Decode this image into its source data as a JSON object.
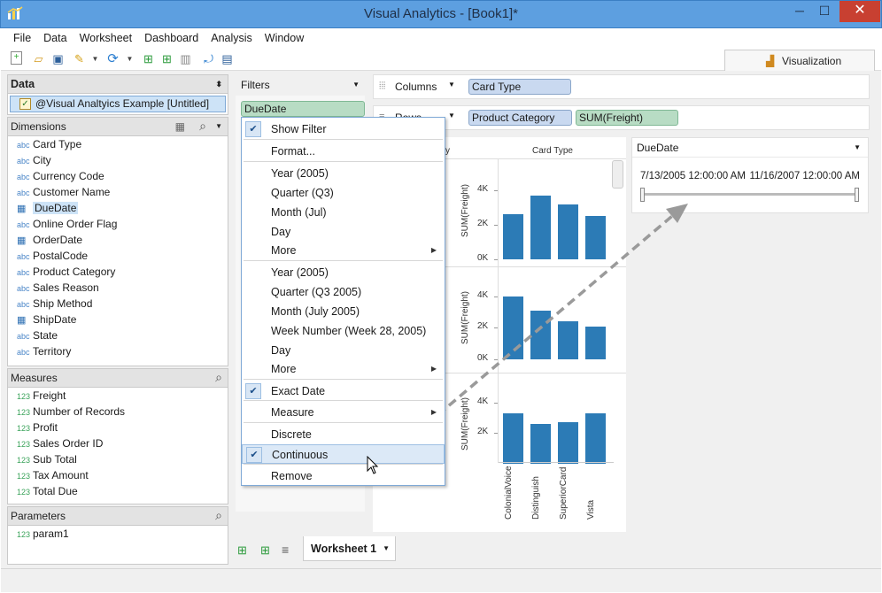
{
  "window": {
    "title": "Visual Analytics - [Book1]*",
    "minimize": "─",
    "maximize": "☐",
    "close": "✕"
  },
  "menu": [
    "File",
    "Data",
    "Worksheet",
    "Dashboard",
    "Analysis",
    "Window"
  ],
  "viz_tab": "Visualization",
  "data_pane": {
    "header": "Data",
    "datasource": "@Visual Analtyics Example [Untitled]",
    "dimensions_header": "Dimensions",
    "dimensions": [
      {
        "type": "abc",
        "label": "Card Type"
      },
      {
        "type": "abc",
        "label": "City"
      },
      {
        "type": "abc",
        "label": "Currency Code"
      },
      {
        "type": "abc",
        "label": "Customer Name"
      },
      {
        "type": "date",
        "label": "DueDate"
      },
      {
        "type": "abc",
        "label": "Online Order Flag"
      },
      {
        "type": "date",
        "label": "OrderDate"
      },
      {
        "type": "abc",
        "label": "PostalCode"
      },
      {
        "type": "abc",
        "label": "Product Category"
      },
      {
        "type": "abc",
        "label": "Sales Reason"
      },
      {
        "type": "abc",
        "label": "Ship Method"
      },
      {
        "type": "date",
        "label": "ShipDate"
      },
      {
        "type": "abc",
        "label": "State"
      },
      {
        "type": "abc",
        "label": "Territory"
      }
    ],
    "measures_header": "Measures",
    "measures": [
      {
        "type": "123",
        "label": "Freight"
      },
      {
        "type": "123",
        "label": "Number of Records"
      },
      {
        "type": "123",
        "label": "Profit"
      },
      {
        "type": "123",
        "label": "Sales Order ID"
      },
      {
        "type": "123",
        "label": "Sub Total"
      },
      {
        "type": "123",
        "label": "Tax Amount"
      },
      {
        "type": "123",
        "label": "Total Due"
      }
    ],
    "parameters_header": "Parameters",
    "parameters": [
      {
        "type": "123",
        "label": "param1"
      }
    ]
  },
  "filters": {
    "header": "Filters",
    "pill": "DueDate"
  },
  "shelves": {
    "columns_label": "Columns",
    "columns_pills": [
      "Card Type"
    ],
    "rows_label": "Rows",
    "rows_pills": [
      "Product Category",
      "SUM(Freight)"
    ]
  },
  "context_menu": [
    {
      "label": "Show Filter",
      "checked": true
    },
    {
      "label": "Format..."
    },
    {
      "label": "Year (2005)"
    },
    {
      "label": "Quarter (Q3)"
    },
    {
      "label": "Month (Jul)"
    },
    {
      "label": "Day"
    },
    {
      "label": "More",
      "submenu": true
    },
    {
      "label": "Year (2005)"
    },
    {
      "label": "Quarter (Q3 2005)"
    },
    {
      "label": "Month (July 2005)"
    },
    {
      "label": "Week Number (Week 28, 2005)"
    },
    {
      "label": "Day"
    },
    {
      "label": "More",
      "submenu": true
    },
    {
      "label": "Exact Date",
      "checked": true
    },
    {
      "label": "Measure",
      "submenu": true
    },
    {
      "label": "Discrete"
    },
    {
      "label": "Continuous",
      "checked": true,
      "highlighted": true
    },
    {
      "label": "Remove"
    }
  ],
  "filter_card": {
    "title": "DueDate",
    "start": "7/13/2005 12:00:00 AM",
    "end": "11/16/2007 12:00:00 AM"
  },
  "chart_data": {
    "type": "bar",
    "column_header_left": "y",
    "column_header": "Card Type",
    "categories": [
      "ColonialVoice",
      "Distinguish",
      "SuperiorCard",
      "Vista"
    ],
    "ylabel": "SUM(Freight)",
    "yticks": [
      "4K",
      "2K",
      "0K"
    ],
    "panes": [
      {
        "values": [
          2600,
          3700,
          3200,
          2500
        ]
      },
      {
        "values": [
          4000,
          3100,
          2400,
          2100
        ]
      },
      {
        "values": [
          3300,
          2600,
          2700,
          3300
        ]
      }
    ],
    "ylim": [
      0,
      5000
    ]
  },
  "sheet_tabs": {
    "active": "Worksheet 1"
  }
}
